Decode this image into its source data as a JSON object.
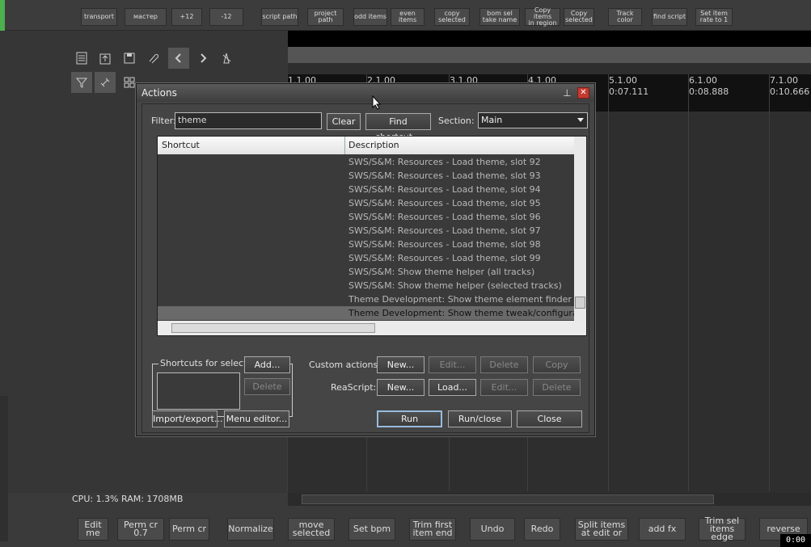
{
  "toolbar_top": [
    "transport",
    "мастер",
    "+12",
    "-12",
    "script path",
    "project\npath",
    "odd items",
    "even items",
    "copy\nselected",
    "bom sel\ntake name",
    "Copy items\nin region",
    "Copy\nselected",
    "Track\ncolor",
    "find script",
    "Set item\nrate to 1"
  ],
  "ruler": [
    {
      "bar": "1.1.00",
      "time": ""
    },
    {
      "bar": "2.1.00",
      "time": ""
    },
    {
      "bar": "3.1.00",
      "time": ""
    },
    {
      "bar": "4.1.00",
      "time": ""
    },
    {
      "bar": "5.1.00",
      "time": "0:07.111"
    },
    {
      "bar": "6.1.00",
      "time": "0:08.888"
    },
    {
      "bar": "7.1.00",
      "time": "0:10.666"
    }
  ],
  "status": {
    "cpu": "CPU: 1.3%  RAM: 1708MB"
  },
  "bottom_buttons": [
    "Edit\nme",
    "Perm cr\n0.7",
    "Perm cr",
    "Normalize",
    "move\nselected",
    "Set bpm",
    "Trim first\nitem end",
    "Undo",
    "Redo",
    "Split items\nat edit or",
    "add fx",
    "Trim sel\nitems edge",
    "reverse"
  ],
  "timer": "0:00",
  "dialog": {
    "title": "Actions",
    "filter_label": "Filter:",
    "filter_value": "theme",
    "clear": "Clear",
    "find_shortcut": "Find shortcut...",
    "section_label": "Section:",
    "section_value": "Main",
    "col_shortcut": "Shortcut",
    "col_description": "Description",
    "rows": [
      "SWS/S&M: Resources - Load theme, slot 92",
      "SWS/S&M: Resources - Load theme, slot 93",
      "SWS/S&M: Resources - Load theme, slot 94",
      "SWS/S&M: Resources - Load theme, slot 95",
      "SWS/S&M: Resources - Load theme, slot 96",
      "SWS/S&M: Resources - Load theme, slot 97",
      "SWS/S&M: Resources - Load theme, slot 98",
      "SWS/S&M: Resources - Load theme, slot 99",
      "SWS/S&M: Show theme helper (all tracks)",
      "SWS/S&M: Show theme helper (selected tracks)",
      "Theme Development: Show theme element finder",
      "Theme Development: Show theme tweak/configuration window"
    ],
    "shortcuts_group": "Shortcuts for selected action",
    "add": "Add...",
    "delete": "Delete",
    "custom_actions_label": "Custom actions:",
    "reascript_label": "ReaScript:",
    "new": "New...",
    "edit": "Edit...",
    "copy": "Copy",
    "load": "Load...",
    "import_export": "Import/export...",
    "menu_editor": "Menu editor...",
    "run": "Run",
    "run_close": "Run/close",
    "close": "Close"
  }
}
